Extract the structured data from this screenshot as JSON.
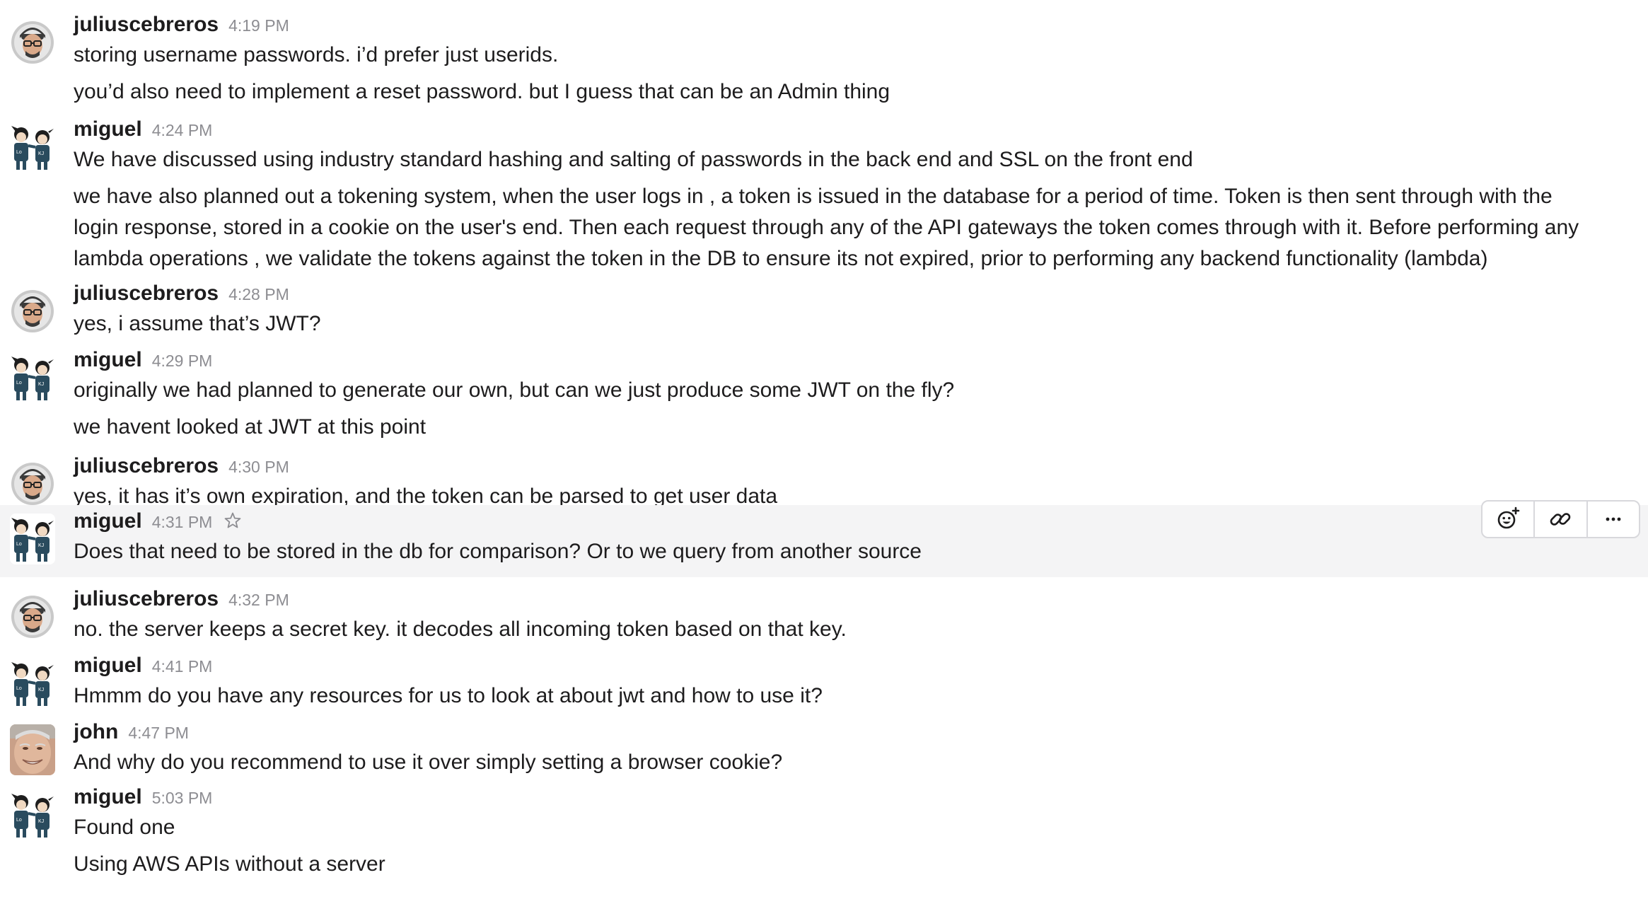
{
  "messages": [
    {
      "user": "juliuscebreros",
      "time": "4:19 PM",
      "avatar": "avatar-julius-icon",
      "lines": [
        "storing username passwords. i’d prefer just userids.",
        "you’d also need to implement a reset password. but I guess that can be an Admin thing"
      ]
    },
    {
      "user": "miguel",
      "time": "4:24 PM",
      "avatar": "avatar-miguel-icon",
      "lines": [
        "We have discussed using industry standard hashing and salting of passwords in the back end and SSL on the front end",
        "we have also planned out a tokening system, when the user logs in , a token is issued in the database for a period of time. Token is then sent through with the login response, stored in a cookie on the user's end. Then each request through any of the API gateways the token comes through with it. Before performing any lambda operations , we validate the tokens against the token in the DB to ensure its not expired, prior to performing any backend functionality (lambda)"
      ]
    },
    {
      "user": "juliuscebreros",
      "time": "4:28 PM",
      "avatar": "avatar-julius-icon",
      "lines": [
        "yes, i assume that’s JWT?"
      ]
    },
    {
      "user": "miguel",
      "time": "4:29 PM",
      "avatar": "avatar-miguel-icon",
      "lines": [
        "originally we had planned to generate our own, but can we just produce some JWT on the fly?",
        "we havent looked at JWT at this point"
      ]
    },
    {
      "user": "juliuscebreros",
      "time": "4:30 PM",
      "avatar": "avatar-julius-icon",
      "lines": [
        "yes, it has it’s own expiration, and the token can be parsed to get user data"
      ]
    },
    {
      "user": "miguel",
      "time": "4:31 PM",
      "avatar": "avatar-miguel-icon",
      "lines": [
        "Does that need to be stored in the db for comparison? Or to we query from another source"
      ]
    },
    {
      "user": "juliuscebreros",
      "time": "4:32 PM",
      "avatar": "avatar-julius-icon",
      "lines": [
        "no. the server keeps a secret key. it decodes all incoming token based on that key."
      ]
    },
    {
      "user": "miguel",
      "time": "4:41 PM",
      "avatar": "avatar-miguel-icon",
      "lines": [
        "Hmmm do you have any resources for us to look at about jwt and how to use it?"
      ]
    },
    {
      "user": "john",
      "time": "4:47 PM",
      "avatar": "avatar-john-icon",
      "lines": [
        "And why do you recommend to use it over simply setting a browser cookie?"
      ]
    },
    {
      "user": "miguel",
      "time": "5:03 PM",
      "avatar": "avatar-miguel-icon",
      "lines": [
        "Found one",
        "Using AWS APIs without a server"
      ]
    }
  ],
  "hover_actions": [
    {
      "icon": "add-reaction-icon"
    },
    {
      "icon": "link-icon"
    },
    {
      "icon": "more-actions-icon"
    }
  ],
  "hover_star_icon": "star-outline-icon",
  "colors": {
    "text": "#1d1c1d",
    "timestamp": "#8d8d92",
    "hover_bg": "#f4f4f5",
    "border": "#d8d8dc"
  }
}
